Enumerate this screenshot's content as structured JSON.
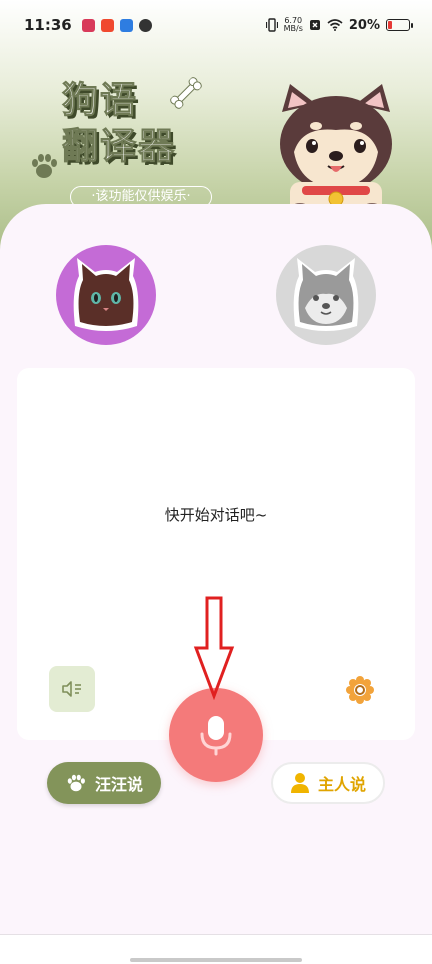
{
  "status_bar": {
    "time": "11:36",
    "speed_value": "6.70",
    "speed_unit": "MB/s",
    "battery": "20%",
    "battery_level": 0.2
  },
  "header": {
    "title_line1": "狗语",
    "title_line2": "翻译器",
    "subtitle": "·该功能仅供娱乐·"
  },
  "main": {
    "empty_prompt": "快开始对话吧~"
  },
  "buttons": {
    "bark_label": "汪汪说",
    "owner_label": "主人说"
  },
  "colors": {
    "cat_avatar_bg": "#c46bd6",
    "dog_avatar_bg": "#d8d8d8",
    "mic_button": "#f47a7a",
    "bark_button": "#83945a",
    "owner_text": "#e0a400"
  },
  "icons": {
    "mic": "microphone-icon",
    "speaker": "speaker-icon",
    "gear": "gear-icon",
    "paw": "paw-icon",
    "person": "person-icon"
  }
}
